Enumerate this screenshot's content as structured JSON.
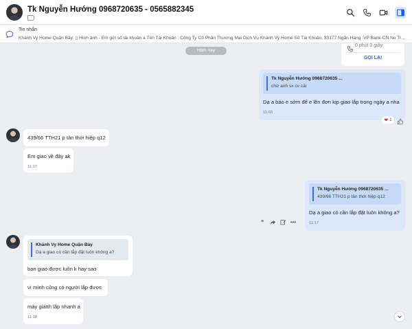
{
  "header": {
    "contact_name": "Tk Nguyễn Hướng 0968720635 - 0565882345",
    "icons": [
      "search-icon",
      "phone-icon",
      "video-icon",
      "sidebar-toggle-icon"
    ]
  },
  "pinned": {
    "title": "Tin nhắn",
    "text": "Khánh Vy Home Quận Bảy: ▯ Hình ảnh - Em gửi số tài khoản a Tên Tài Khoản : Công Ty Cổ Phần Thương Mại Dịch Vụ Khánh Vy Home Số Tài Khoản: 33177 Ngân Hàng :VP Bank-CN No Trang L..."
  },
  "date_divider": "Hôm nay",
  "call_card": {
    "duration": "0 phút 0 giây",
    "call_back": "GỌI LẠI"
  },
  "messages": {
    "m1": {
      "quote_author": "Tk Nguyễn Hướng 0968720635 ...",
      "quote_text": "chờ anh sx cv cái",
      "text": "Dạ a báo e sớm để e lên đơn kịp giao lắp trong ngày a nha",
      "time": "11:03",
      "reaction_count": "1"
    },
    "m2": {
      "text": "439/66 TTH21 p tân thới hiệp q12"
    },
    "m3": {
      "text": "Em giao về đây ak",
      "time": "11:17"
    },
    "m4": {
      "quote_author": "Tk Nguyễn Hướng 0968720635 ...",
      "quote_text": "439/66 TTH21 p tân thới hiệp q12",
      "text": "Dạ a giao có cần lắp đặt luôn không a?",
      "time": "11:17"
    },
    "m5": {
      "quote_author": "Khánh Vy Home Quận Bảy",
      "quote_text": "Dạ a giao có cần lắp đặt luôn không a?",
      "text": "bạn giao được luôn k hay sao"
    },
    "m6": {
      "text": "vì mình cũng có người lắp được"
    },
    "m7": {
      "text": "máy giátth lắp nhanh á",
      "time": "11:18"
    }
  },
  "colors": {
    "outgoing_bubble": "#dbe7fb",
    "incoming_bubble": "#ffffff",
    "accent": "#2b6ad6",
    "background": "#eceef1"
  }
}
